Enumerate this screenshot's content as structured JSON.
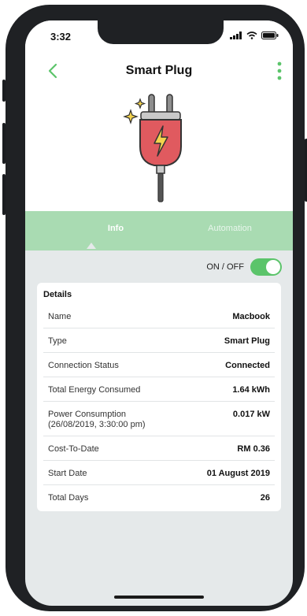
{
  "status_bar": {
    "time": "3:32"
  },
  "header": {
    "title": "Smart Plug"
  },
  "tabs": [
    {
      "label": "Info"
    },
    {
      "label": "Automation"
    }
  ],
  "power_toggle": {
    "label": "ON / OFF",
    "state": "on",
    "color": "#5bc46a"
  },
  "details": {
    "title": "Details",
    "rows": [
      {
        "label": "Name",
        "value": "Macbook"
      },
      {
        "label": "Type",
        "value": "Smart Plug"
      },
      {
        "label": "Connection Status",
        "value": "Connected"
      },
      {
        "label": "Total Energy Consumed",
        "value": "1.64 kWh"
      },
      {
        "label": "Power Consumption\n(26/08/2019, 3:30:00 pm)",
        "value": "0.017 kW"
      },
      {
        "label": "Cost-To-Date",
        "value": "RM 0.36"
      },
      {
        "label": "Start Date",
        "value": "01 August 2019"
      },
      {
        "label": "Total Days",
        "value": "26"
      }
    ]
  },
  "colors": {
    "accent": "#5bc46a",
    "tab_bar": "#a9dbb2",
    "plug_red": "#e05a5f"
  },
  "icons": [
    "back-chevron-icon",
    "more-vertical-icon",
    "smart-plug-icon",
    "signal-icon",
    "wifi-icon",
    "battery-icon"
  ]
}
